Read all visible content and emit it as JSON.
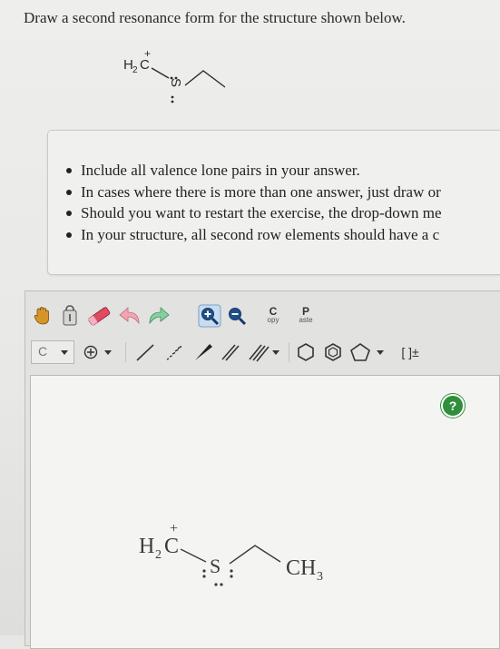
{
  "question": "Draw a second resonance form for the structure shown below.",
  "mini_structure": {
    "group": "H",
    "group_sub": "2",
    "carbon": "C",
    "charge": "+",
    "sulfur": "S"
  },
  "instructions": [
    "Include all valence lone pairs in your answer.",
    "In cases where there is more than one answer, just draw or",
    "Should you want to restart the exercise, the drop-down me",
    "In your structure, all second row elements should have a c"
  ],
  "toolbar": {
    "copy_letter": "C",
    "copy_rest": "opy",
    "paste_letter": "P",
    "paste_rest": "aste",
    "element": "C",
    "bracket_label": "[ ]±"
  },
  "canvas": {
    "help": "?",
    "structure": {
      "group": "H",
      "group_sub": "2",
      "carbon": "C",
      "charge": "+",
      "sulfur": "S",
      "methyl": "CH",
      "methyl_sub": "3"
    }
  }
}
